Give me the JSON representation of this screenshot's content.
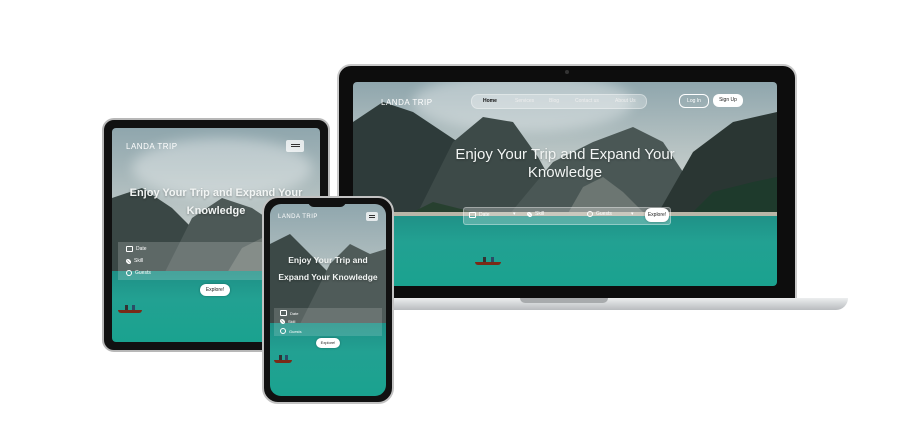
{
  "brand": "LANDA TRIP",
  "hero_title": "Enjoy Your Trip and Expand Your Knowledge",
  "hero_line1": "Enjoy Your Trip and Expand Your",
  "hero_line2": "Knowledge",
  "phone_line1": "Enjoy Your Trip and",
  "phone_line2": "Expand Your Knowledge",
  "nav": {
    "items": [
      "Home",
      "Services",
      "Blog",
      "Contact us",
      "About Us"
    ],
    "login": "Log In",
    "signup": "Sign Up"
  },
  "search": {
    "date": "Date",
    "skill": "Skill",
    "guests": "Guests",
    "explore": "Explore!"
  },
  "colors": {
    "lake": "#1fa08f",
    "bezel": "#111111",
    "laptop_silver": "#d9dbdd"
  },
  "icons": [
    "calendar-icon",
    "network-icon",
    "user-icon",
    "menu-icon",
    "chevron-down-icon"
  ]
}
